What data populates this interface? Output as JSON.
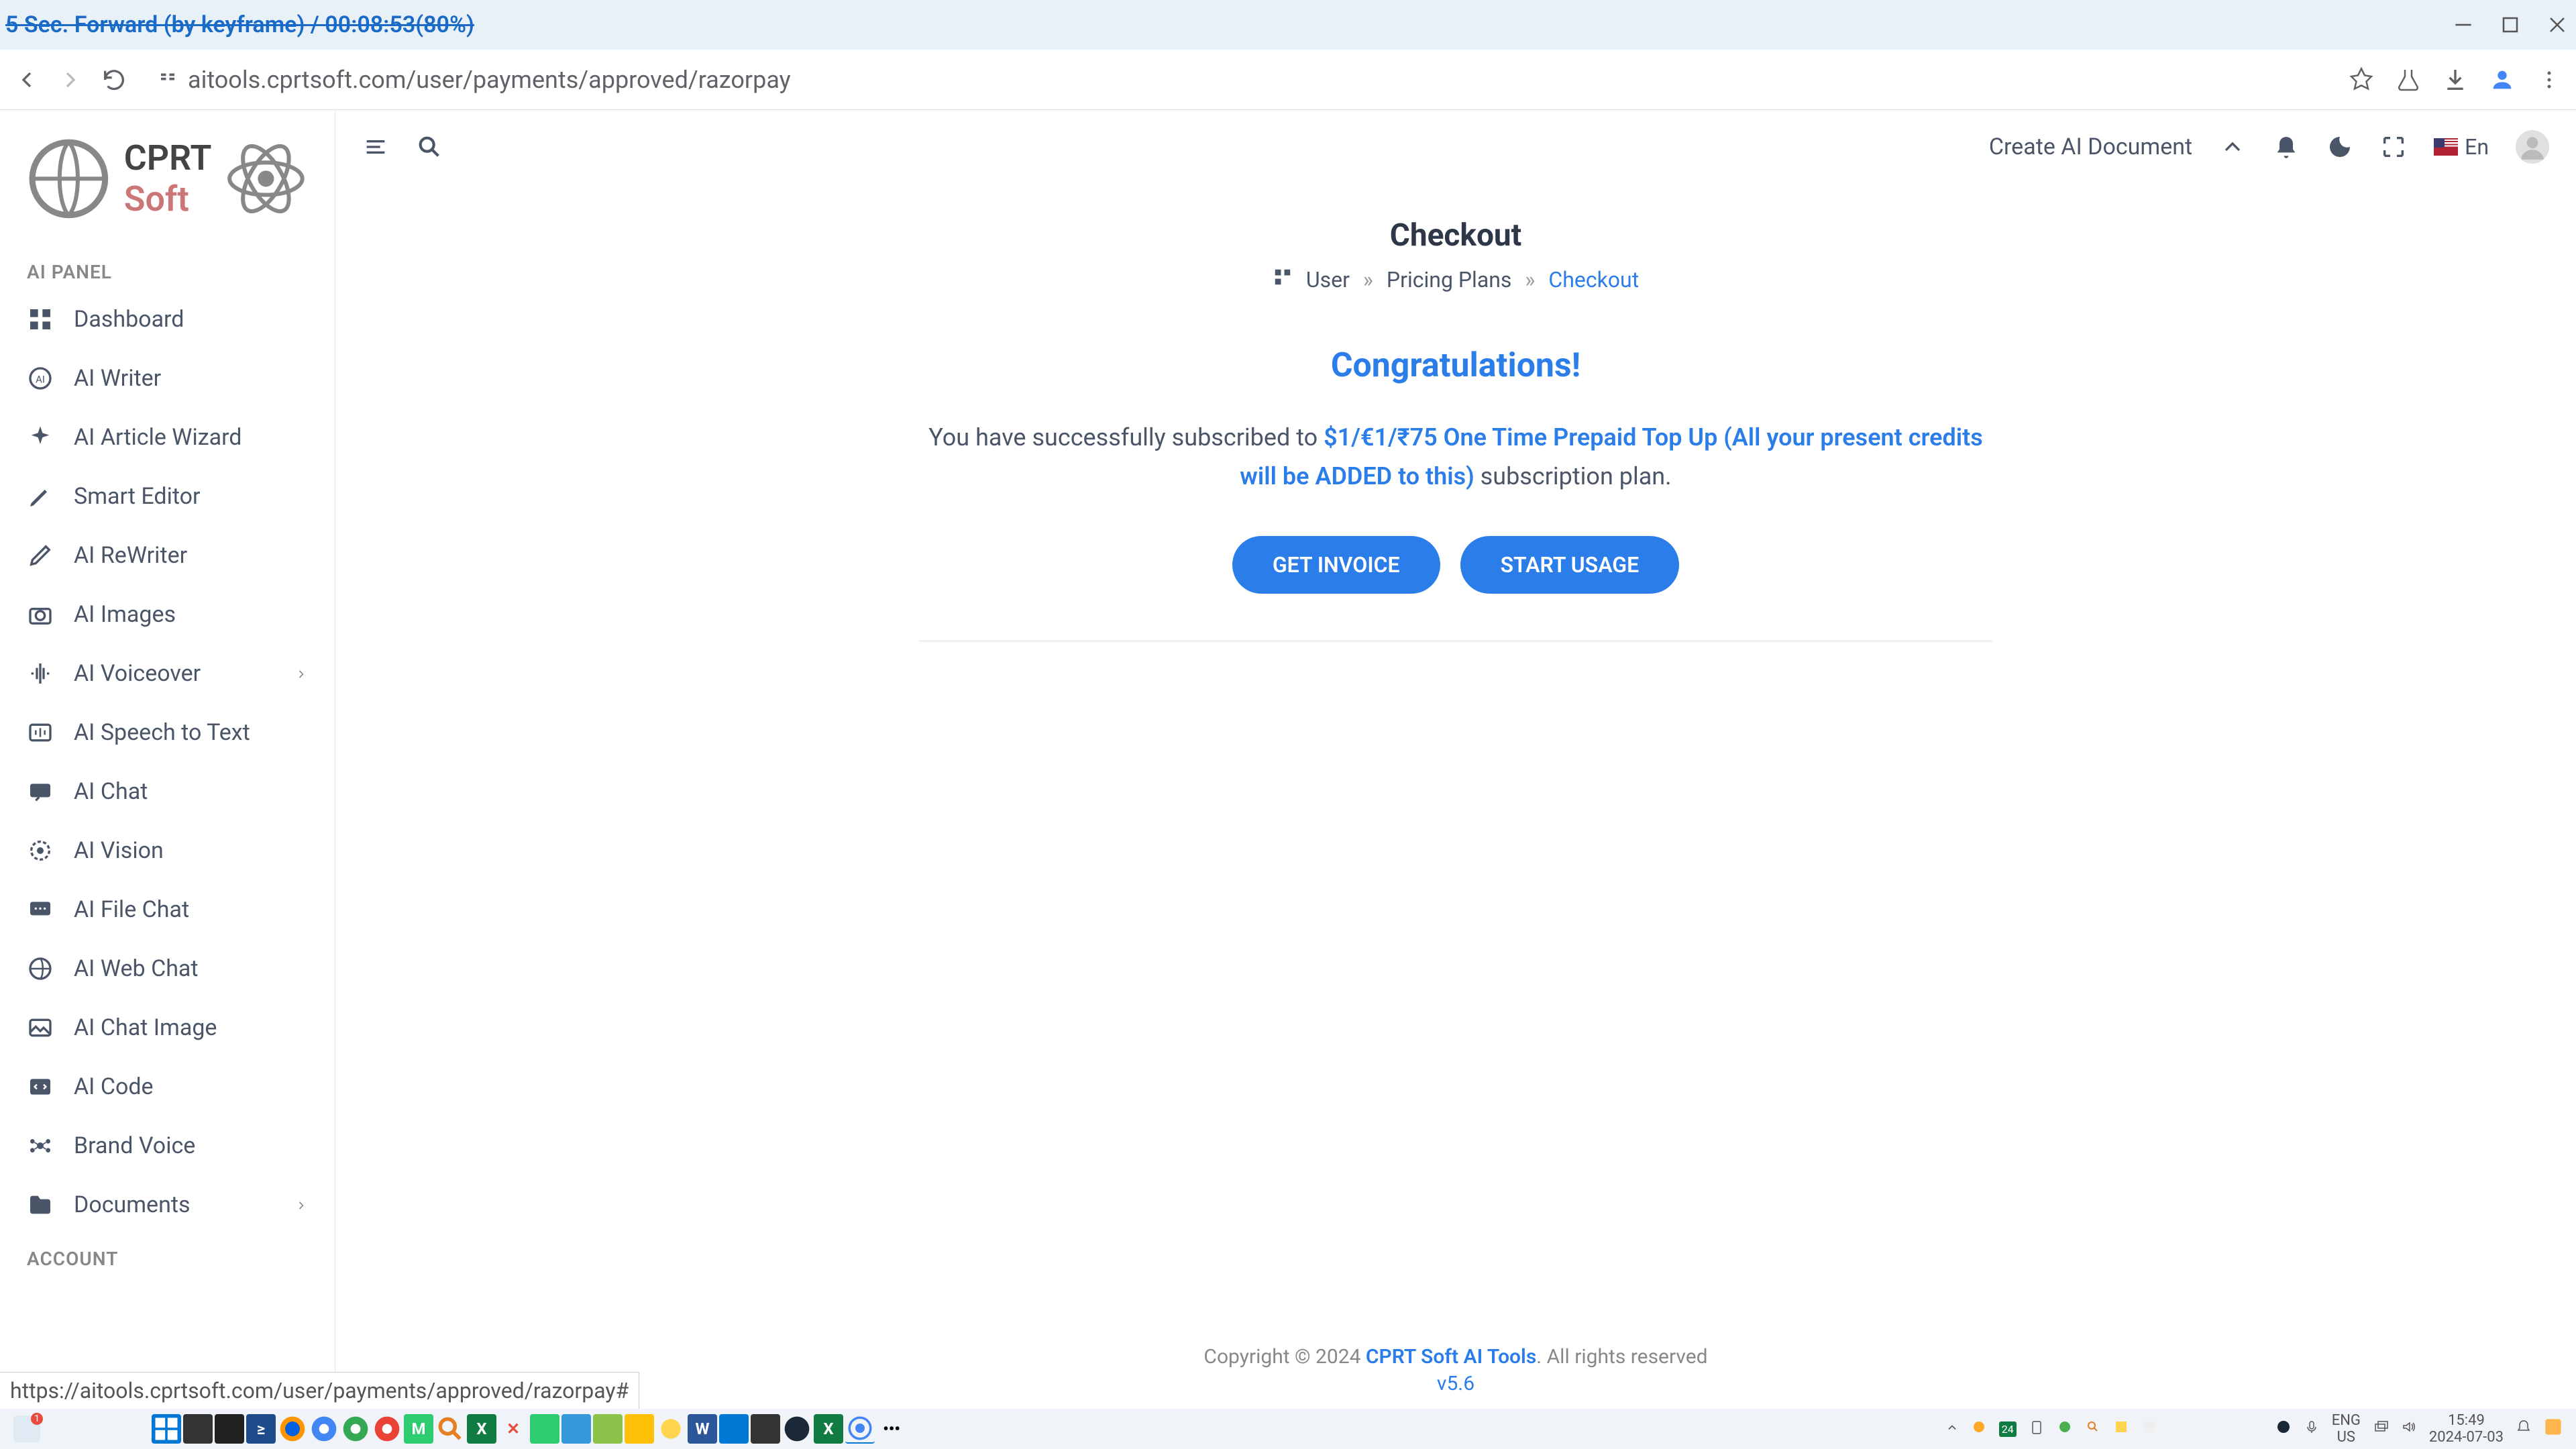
{
  "window": {
    "title": "5 Sec. Forward (by keyframe) / 00:08:53(80%)"
  },
  "browser": {
    "url": "aitools.cprtsoft.com/user/payments/approved/razorpay",
    "status_url": "https://aitools.cprtsoft.com/user/payments/approved/razorpay#"
  },
  "logo": {
    "brand1": "CPRT",
    "brand2": " Soft"
  },
  "sidebar": {
    "section1": "AI PANEL",
    "section2": "ACCOUNT",
    "items": [
      {
        "label": "Dashboard",
        "icon": "grid"
      },
      {
        "label": "AI Writer",
        "icon": "ai-circle"
      },
      {
        "label": "AI Article Wizard",
        "icon": "sparkle"
      },
      {
        "label": "Smart Editor",
        "icon": "pen"
      },
      {
        "label": "AI ReWriter",
        "icon": "edit"
      },
      {
        "label": "AI Images",
        "icon": "camera"
      },
      {
        "label": "AI Voiceover",
        "icon": "sound",
        "chevron": true
      },
      {
        "label": "AI Speech to Text",
        "icon": "mic"
      },
      {
        "label": "AI Chat",
        "icon": "chat"
      },
      {
        "label": "AI Vision",
        "icon": "eye"
      },
      {
        "label": "AI File Chat",
        "icon": "file-chat"
      },
      {
        "label": "AI Web Chat",
        "icon": "globe"
      },
      {
        "label": "AI Chat Image",
        "icon": "image"
      },
      {
        "label": "AI Code",
        "icon": "code"
      },
      {
        "label": "Brand Voice",
        "icon": "brand"
      },
      {
        "label": "Documents",
        "icon": "folder",
        "chevron": true
      }
    ]
  },
  "header": {
    "create_doc": "Create AI Document",
    "lang": "En"
  },
  "page": {
    "title": "Checkout",
    "breadcrumb": {
      "item1": "User",
      "item2": "Pricing Plans",
      "item3": "Checkout"
    },
    "congrats": "Congratulations!",
    "success_prefix": "You have successfully subscribed to ",
    "plan_name": "$1/€1/₹75 One Time Prepaid Top Up (All your present credits will be ADDED to this)",
    "success_suffix": " subscription plan.",
    "btn_invoice": "GET INVOICE",
    "btn_start": "START USAGE"
  },
  "footer": {
    "copyright_prefix": "Copyright © 2024 ",
    "brand": "CPRT Soft AI Tools",
    "copyright_suffix": ". All rights reserved",
    "version": "v5.6"
  },
  "taskbar": {
    "lang1": "ENG",
    "lang2": "US",
    "time": "15:49",
    "date": "2024-07-03"
  }
}
